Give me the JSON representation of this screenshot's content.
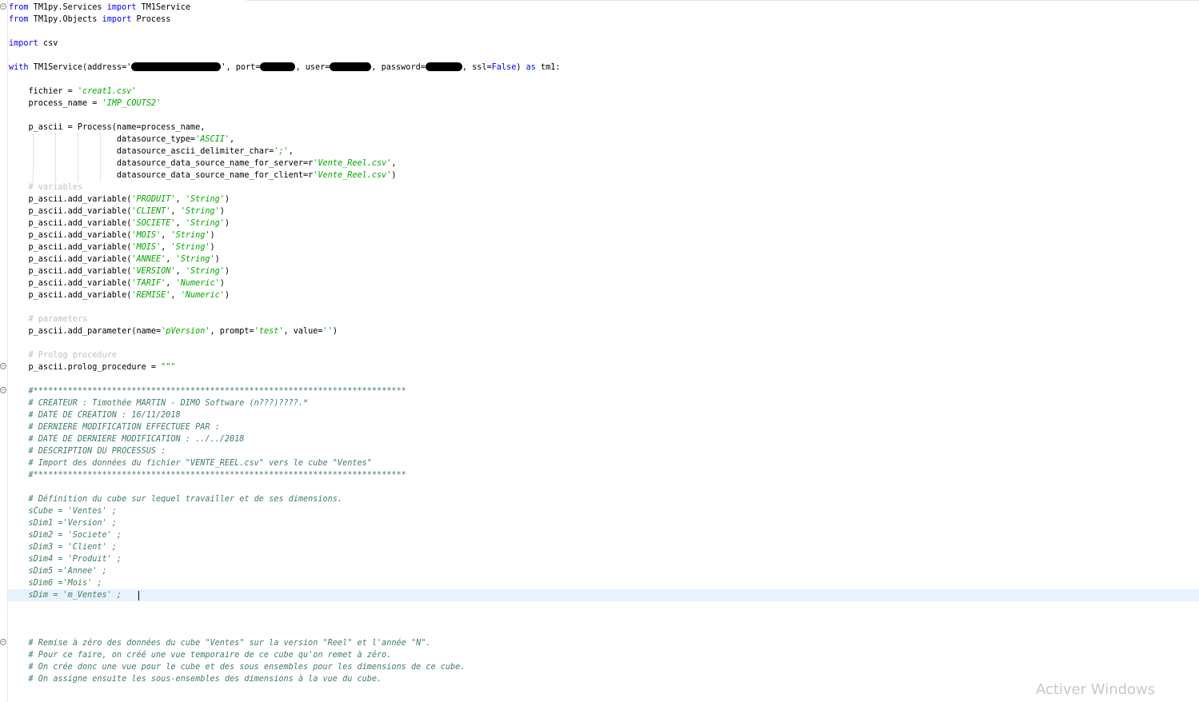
{
  "editor": {
    "lines": [
      {
        "id": "l1",
        "text": "from TM1py.Services import TM1Service"
      },
      {
        "id": "l2",
        "text": "from TM1py.Objects import Process"
      },
      {
        "id": "l3",
        "text": "import csv"
      },
      {
        "id": "l4",
        "text": "with TM1Service(address='",
        "mid": "', port=",
        "mid2": ", user=",
        "mid3": ", password=",
        "tail": ", ssl=False) as tm1:"
      },
      {
        "id": "l5",
        "text": "    fichier = 'creat1.csv'"
      },
      {
        "id": "l6",
        "text": "    process_name = 'IMP_COUTS2'"
      },
      {
        "id": "l7",
        "text": "    p_ascii = Process(name=process_name,"
      },
      {
        "id": "l8",
        "text": "                      datasource_type='ASCII',"
      },
      {
        "id": "l9",
        "text": "                      datasource_ascii_delimiter_char=';',"
      },
      {
        "id": "l10",
        "text": "                      datasource_data_source_name_for_server=r'Vente_Reel.csv',"
      },
      {
        "id": "l11",
        "text": "                      datasource_data_source_name_for_client=r'Vente_Reel.csv')"
      },
      {
        "id": "l12",
        "text": "    # variables"
      },
      {
        "id": "l13",
        "text": "    p_ascii.add_variable('PRODUIT', 'String')"
      },
      {
        "id": "l14",
        "text": "    p_ascii.add_variable('CLIENT', 'String')"
      },
      {
        "id": "l15",
        "text": "    p_ascii.add_variable('SOCIETE', 'String')"
      },
      {
        "id": "l16",
        "text": "    p_ascii.add_variable('MOIS', 'String')"
      },
      {
        "id": "l17",
        "text": "    p_ascii.add_variable('MOIS', 'String')"
      },
      {
        "id": "l18",
        "text": "    p_ascii.add_variable('ANNEE', 'String')"
      },
      {
        "id": "l19",
        "text": "    p_ascii.add_variable('VERSION', 'String')"
      },
      {
        "id": "l20",
        "text": "    p_ascii.add_variable('TARIF', 'Numeric')"
      },
      {
        "id": "l21",
        "text": "    p_ascii.add_variable('REMISE', 'Numeric')"
      },
      {
        "id": "l22",
        "text": "    # parameters"
      },
      {
        "id": "l23",
        "text": "    p_ascii.add_parameter(name='pVersion', prompt='test', value='')"
      },
      {
        "id": "l24",
        "text": "    # Prolog procedure"
      },
      {
        "id": "l25",
        "text": "    p_ascii.prolog_procedure = \"\"\""
      },
      {
        "id": "l26",
        "text": "    #****************************************************************************"
      },
      {
        "id": "l27",
        "text": "    # CREATEUR : Timothée MARTIN - DIMO Software (n???)????.*"
      },
      {
        "id": "l28",
        "text": "    # DATE DE CREATION : 16/11/2018"
      },
      {
        "id": "l29",
        "text": "    # DERNIERE MODIFICATION EFFECTUEE PAR :"
      },
      {
        "id": "l30",
        "text": "    # DATE DE DERNIERE MODIFICATION : ../../2018"
      },
      {
        "id": "l31",
        "text": "    # DESCRIPTION DU PROCESSUS :"
      },
      {
        "id": "l32",
        "text": "    # Import des données du fichier \"VENTE_REEL.csv\" vers le cube \"Ventes\""
      },
      {
        "id": "l33",
        "text": "    #****************************************************************************"
      },
      {
        "id": "l34",
        "text": "    # Définition du cube sur lequel travailler et de ses dimensions."
      },
      {
        "id": "l35",
        "text": "    sCube = 'Ventes' ;"
      },
      {
        "id": "l36",
        "text": "    sDim1 ='Version' ;"
      },
      {
        "id": "l37",
        "text": "    sDim2 = 'Societe' ;"
      },
      {
        "id": "l38",
        "text": "    sDim3 = 'Client' ;"
      },
      {
        "id": "l39",
        "text": "    sDim4 = 'Produit' ;"
      },
      {
        "id": "l40",
        "text": "    sDim5 ='Annee' ;"
      },
      {
        "id": "l41",
        "text": "    sDim6 ='Mois' ;"
      },
      {
        "id": "l42",
        "text": "    sDim = 'm_Ventes' ;"
      },
      {
        "id": "l43",
        "text": "    # Remise à zéro des données du cube \"Ventes\" sur la version \"Reel\" et l'année \"N\"."
      },
      {
        "id": "l44",
        "text": "    # Pour ce faire, on créé une vue temporaire de ce cube qu'on remet à zéro."
      },
      {
        "id": "l45",
        "text": "    # On crée donc une vue pour le cube et des sous ensembles pour les dimensions de ce cube."
      },
      {
        "id": "l46",
        "text": "    # On assigne ensuite les sous-ensembles des dimensions à la vue du cube."
      }
    ],
    "fold_marker": "−"
  },
  "watermark": "Activer Windows",
  "colors": {
    "keyword": "#0000ff",
    "string": "#00aa00",
    "comment_gray": "#c0c0c0",
    "comment_green": "#3f7f5f",
    "current_line": "#e8f2fe"
  }
}
